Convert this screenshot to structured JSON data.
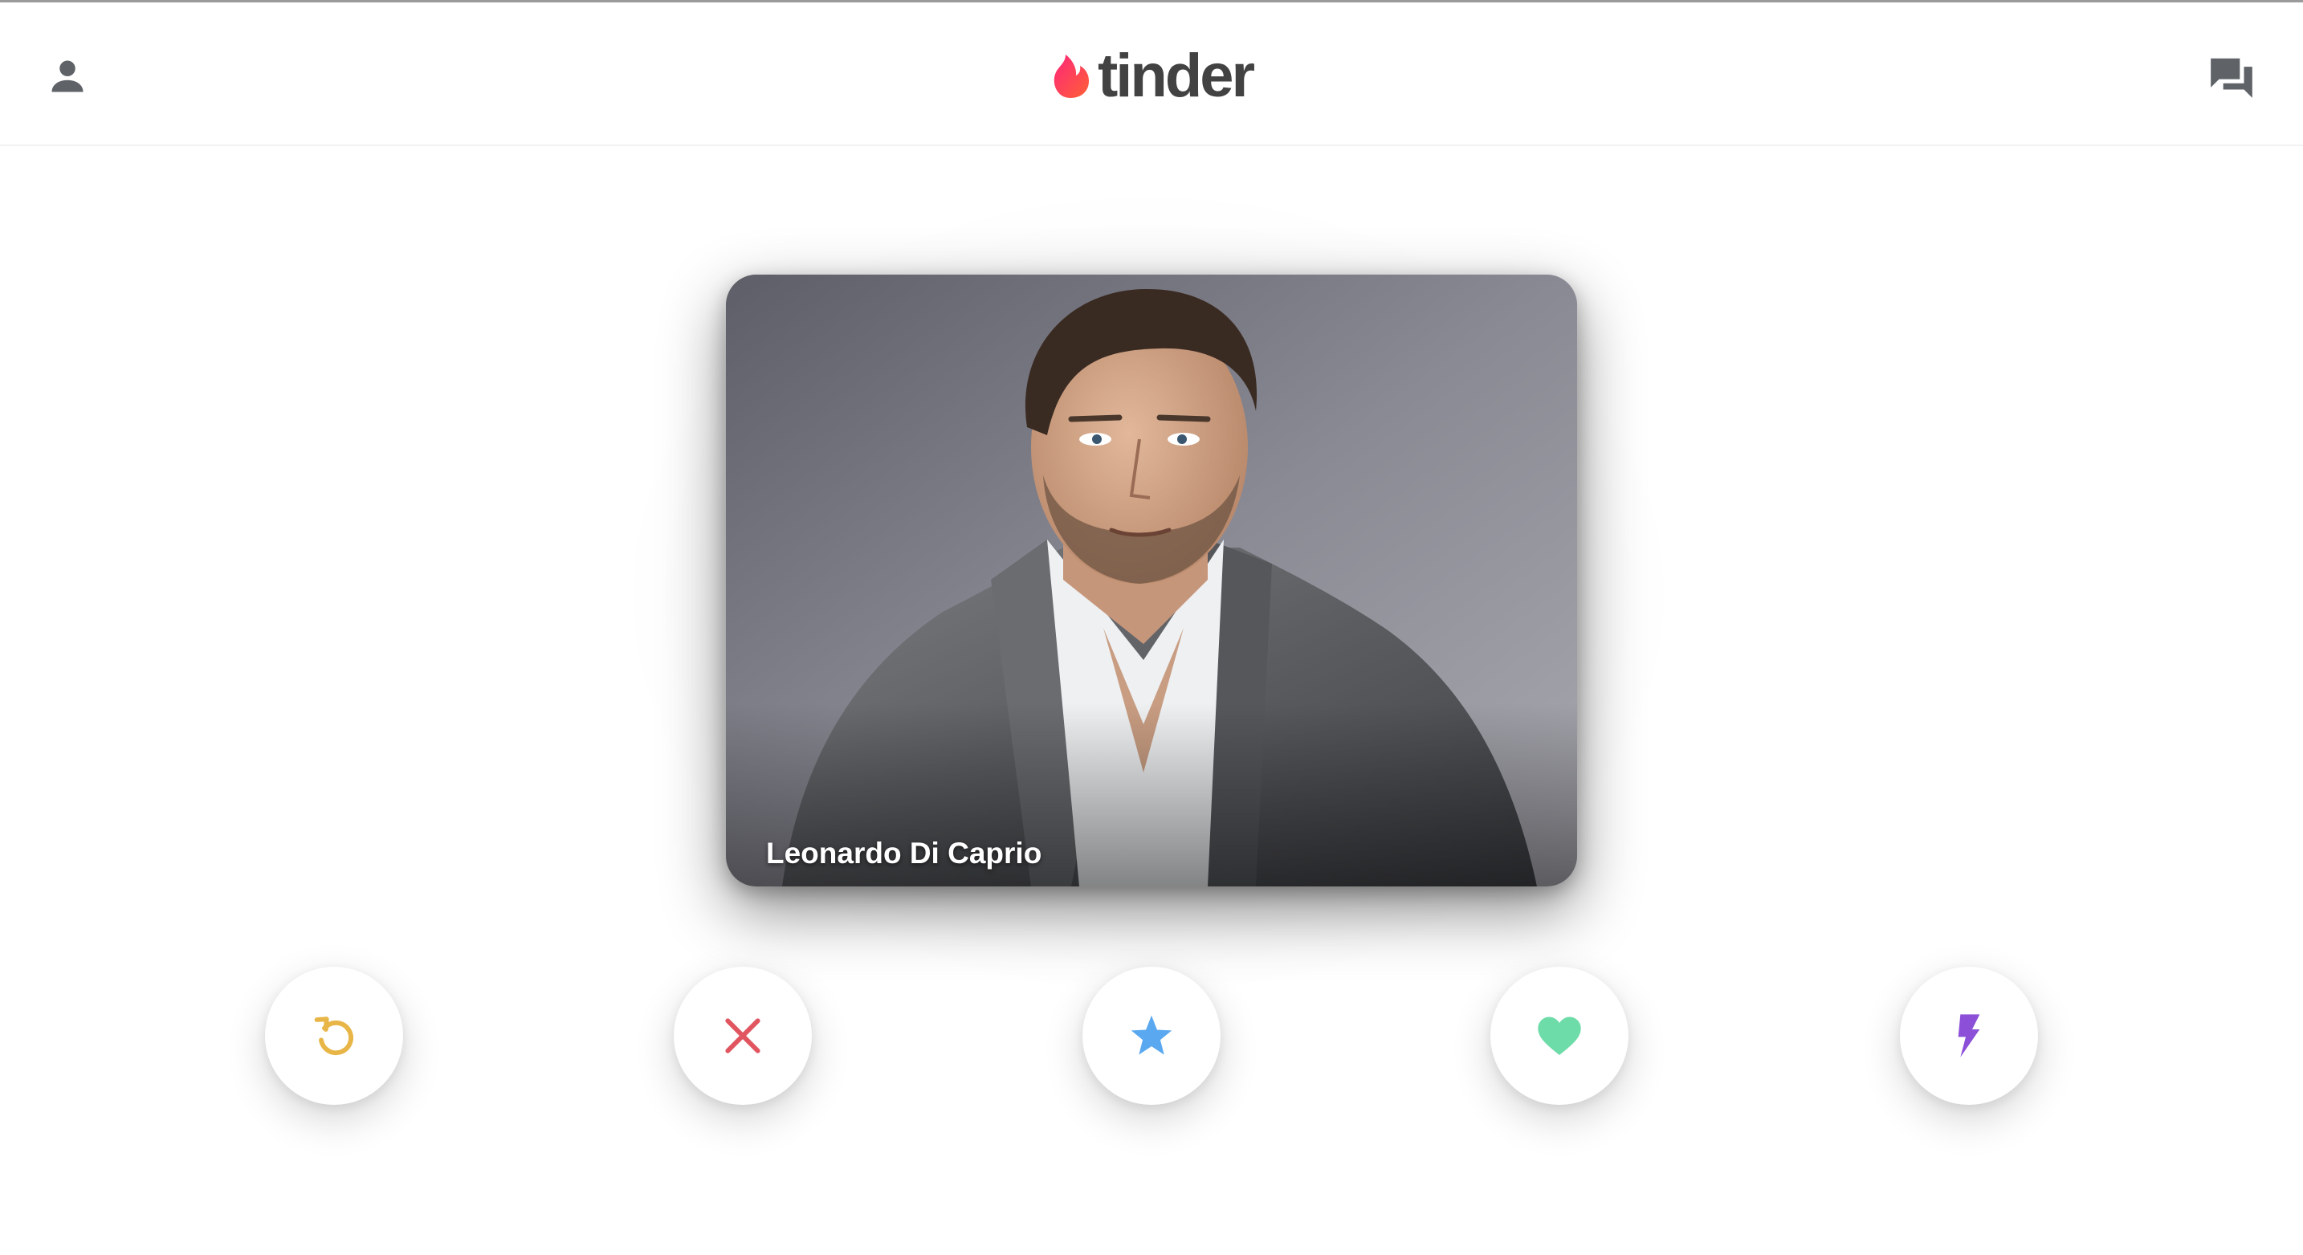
{
  "header": {
    "logo_text": "tinder",
    "profile_icon": "person-icon",
    "messages_icon": "chat-bubbles-icon"
  },
  "card": {
    "name": "Leonardo Di Caprio"
  },
  "actions": [
    {
      "id": "rewind",
      "icon": "rewind-icon",
      "color": "#e8b547"
    },
    {
      "id": "nope",
      "icon": "close-icon",
      "color": "#e0555f"
    },
    {
      "id": "superlike",
      "icon": "star-icon",
      "color": "#5aa8f0"
    },
    {
      "id": "like",
      "icon": "heart-icon",
      "color": "#6ddca8"
    },
    {
      "id": "boost",
      "icon": "lightning-icon",
      "color": "#8b4fd8"
    }
  ],
  "colors": {
    "brand": "#fd5068",
    "logo_text": "#424242",
    "icon_gray": "#5f6368"
  }
}
